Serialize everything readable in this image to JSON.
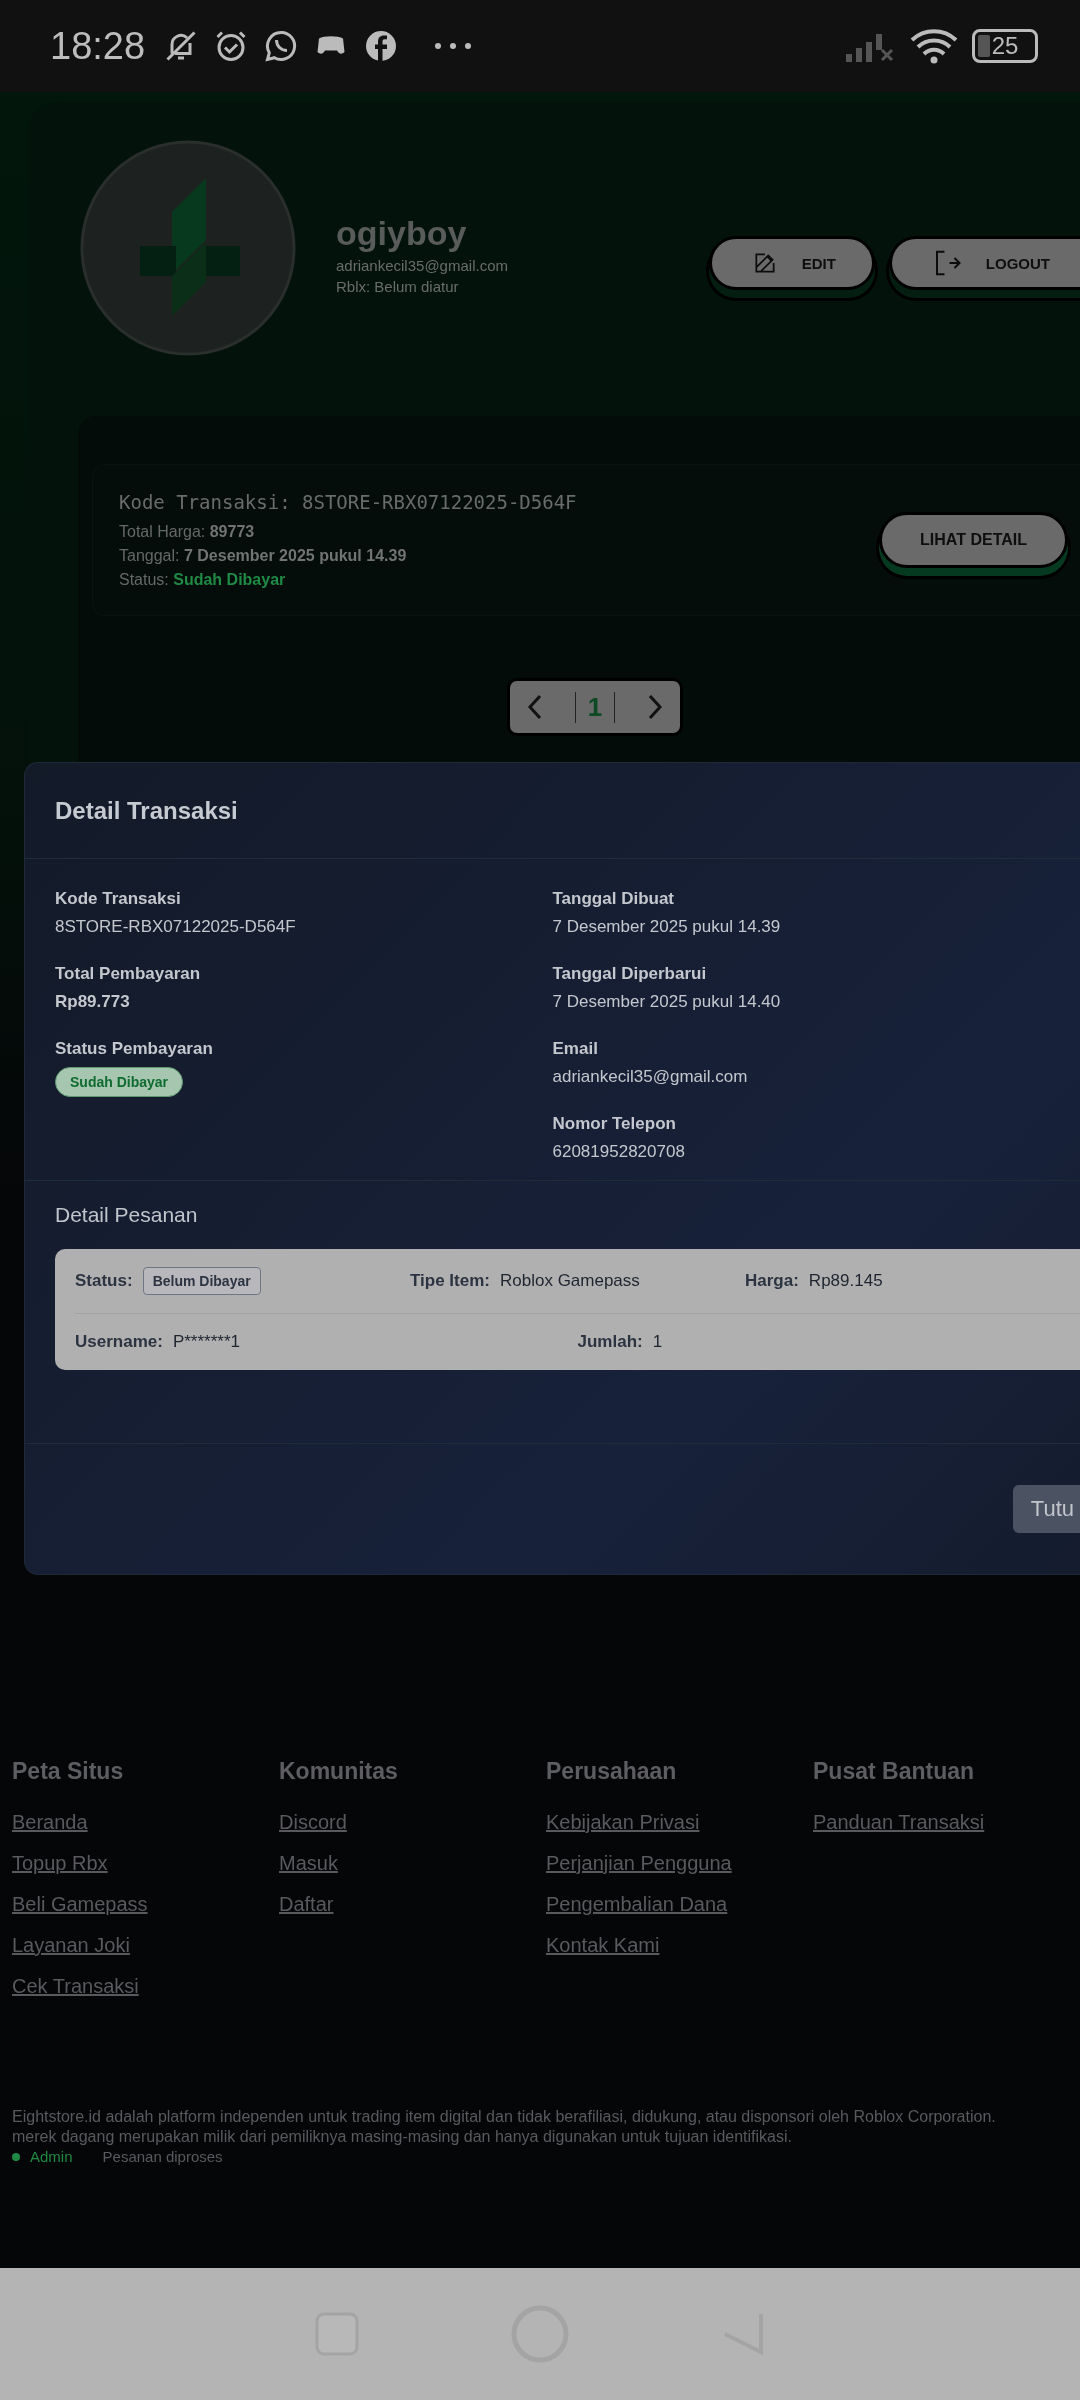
{
  "status_bar": {
    "time": "18:28",
    "battery": "25"
  },
  "profile": {
    "username": "ogiyboy",
    "email": "adriankecil35@gmail.com",
    "roblox": "Rblx: Belum diatur",
    "buttons": [
      {
        "label": "EDIT",
        "kind": "edit"
      },
      {
        "label": "LOGOUT",
        "kind": "logout"
      }
    ]
  },
  "transactions": [
    {
      "code_label": "Kode Transaksi:",
      "code": "8STORE-RBX07122025-D564F",
      "total_label": "Total Harga:",
      "total": "89773",
      "date_label": "Tanggal:",
      "date": "7 Desember 2025 pukul 14.39",
      "status_label": "Status:",
      "status": "Sudah Dibayar",
      "button": "LIHAT DETAIL"
    }
  ],
  "pagination": {
    "pages": [
      {
        "label": "1",
        "selected": true
      }
    ]
  },
  "modal": {
    "title": "Detail Transaksi",
    "left_fields": [
      {
        "label": "Kode Transaksi",
        "value": "8STORE-RBX07122025-D564F",
        "kind": "text"
      },
      {
        "label": "Total Pembayaran",
        "value": "Rp89.773",
        "kind": "bold"
      },
      {
        "label": "Status Pembayaran",
        "value": "Sudah Dibayar",
        "kind": "badge"
      }
    ],
    "right_fields": [
      {
        "label": "Tanggal Dibuat",
        "value": "7 Desember 2025 pukul 14.39",
        "kind": "text"
      },
      {
        "label": "Tanggal Diperbarui",
        "value": "7 Desember 2025 pukul 14.40",
        "kind": "text"
      },
      {
        "label": "Email",
        "value": "adriankecil35@gmail.com",
        "kind": "text"
      },
      {
        "label": "Nomor Telepon",
        "value": "62081952820708",
        "kind": "text"
      }
    ],
    "order_title": "Detail Pesanan",
    "order": {
      "status_label": "Status:",
      "status": "Belum Dibayar",
      "type_label": "Tipe Item:",
      "type": "Roblox Gamepass",
      "price_label": "Harga:",
      "price": "Rp89.145",
      "username_label": "Username:",
      "username": "P*******1",
      "qty_label": "Jumlah:",
      "qty": "1"
    },
    "close_button": "Tutu"
  },
  "footer": {
    "columns": [
      {
        "heading": "Peta Situs",
        "links": [
          "Beranda",
          "Topup Rbx",
          "Beli Gamepass",
          "Layanan Joki",
          "Cek Transaksi"
        ]
      },
      {
        "heading": "Komunitas",
        "links": [
          "Discord",
          "Masuk",
          "Daftar"
        ]
      },
      {
        "heading": "Perusahaan",
        "links": [
          "Kebijakan Privasi",
          "Perjanjian Pengguna",
          "Pengembalian Dana",
          "Kontak Kami"
        ]
      },
      {
        "heading": "Pusat Bantuan",
        "links": [
          "Panduan Transaksi"
        ]
      }
    ],
    "disclaimer": [
      "Eightstore.id adalah platform independen untuk trading item digital dan tidak berafiliasi, didukung, atau disponsori oleh Roblox Corporation.",
      "merek dagang merupakan milik dari pemiliknya masing-masing dan hanya digunakan untuk tujuan identifikasi."
    ]
  },
  "toast": {
    "sender": "Admin",
    "message": "Pesanan diproses"
  }
}
